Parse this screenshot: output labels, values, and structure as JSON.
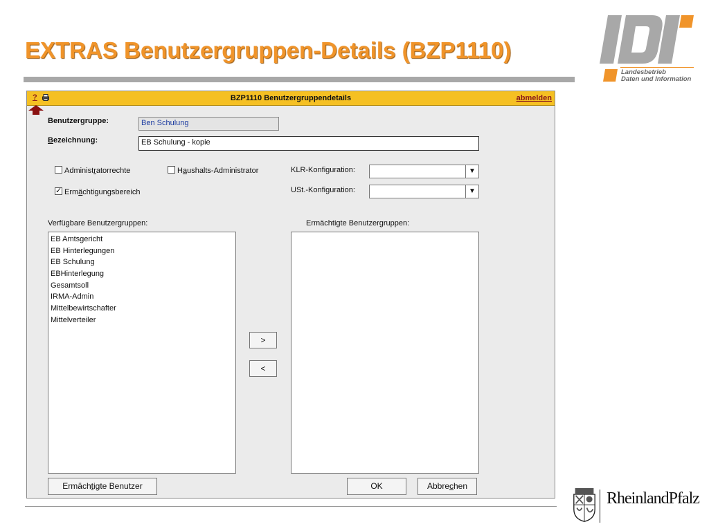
{
  "slide": {
    "title": "EXTRAS Benutzergruppen-Details (BZP1110)",
    "logo_text_line1": "Landesbetrieb",
    "logo_text_line2": "Daten und Information",
    "logo_mark": "ldi",
    "footer_logo_text": "RheinlandPfalz"
  },
  "window": {
    "help_label": "?",
    "print_icon": "printer-icon",
    "title": "BZP1110 Benutzergruppendetails",
    "logout_label": "abmelden"
  },
  "form": {
    "group_label": "Benutzergruppe:",
    "group_value": "Ben Schulung",
    "desc_label_prefix": "",
    "desc_label_ul": "B",
    "desc_label_rest": "ezeichnung:",
    "desc_value": "EB Schulung - kopie",
    "admin_rights": {
      "pre": "Administ",
      "ul": "r",
      "post": "atorrechte",
      "checked": false
    },
    "budget_admin": {
      "pre": "H",
      "ul": "a",
      "post": "ushalts-Administrator",
      "checked": false
    },
    "auth_scope": {
      "pre": "Erm",
      "ul": "ä",
      "post": "chtigungsbereich",
      "checked": true
    },
    "klr_label": "KLR-Konfiguration:",
    "klr_value": "",
    "ust_label": "USt.-Konfiguration:",
    "ust_value": ""
  },
  "lists": {
    "available_label": "Verfügbare Benutzergruppen:",
    "available_items": [
      "EB Amtsgericht",
      "EB Hinterlegungen",
      "EB Schulung",
      "EBHinterlegung",
      "Gesamtsoll",
      "IRMA-Admin",
      "Mittelbewirtschafter",
      "Mittelverteiler"
    ],
    "authorized_label": "Ermächtigte Benutzergruppen:",
    "authorized_items": []
  },
  "buttons": {
    "add": ">",
    "remove": "<",
    "auth_users": {
      "pre": "Ermäch",
      "ul": "t",
      "post": "igte Benutzer"
    },
    "ok": "OK",
    "cancel": {
      "pre": "Abbre",
      "ul": "c",
      "post": "hen"
    }
  },
  "colors": {
    "title_orange": "#f0942a",
    "titlebar_yellow": "#f5c023",
    "link_red": "#8a1a1a"
  }
}
